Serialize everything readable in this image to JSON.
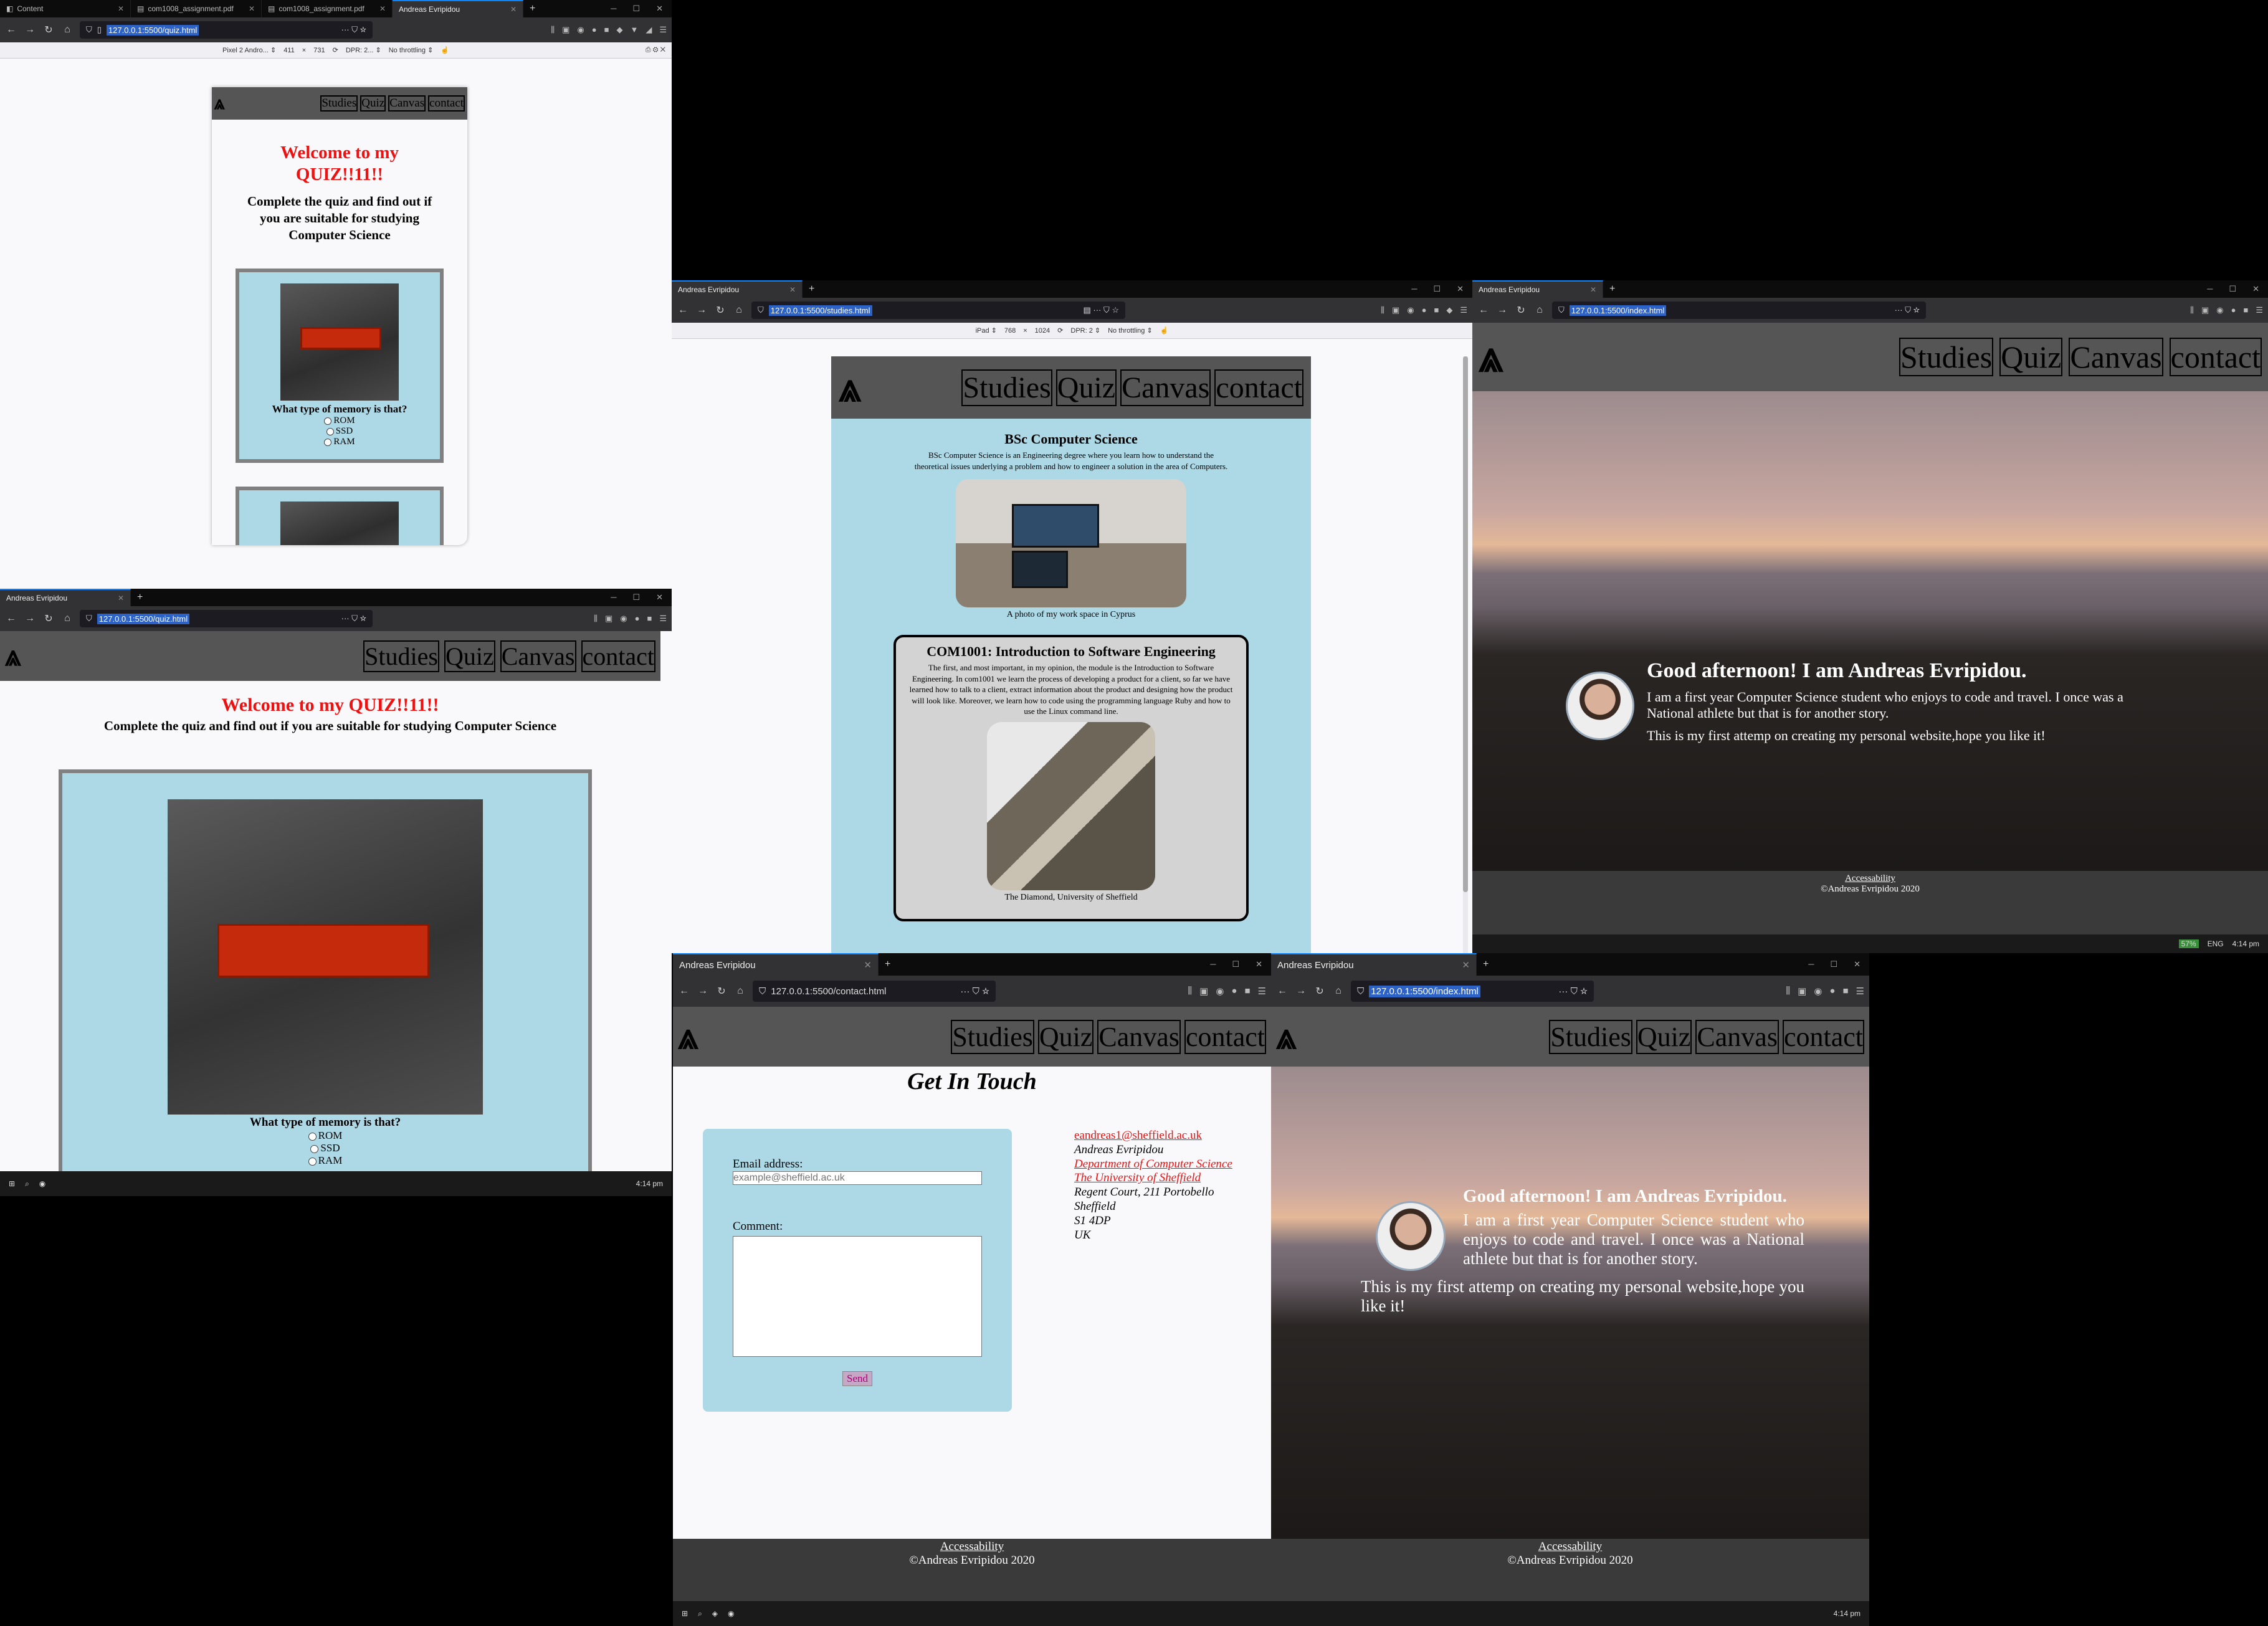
{
  "top_left_window": {
    "tabs": [
      "Content",
      "com1008_assignment.pdf",
      "com1008_assignment.pdf",
      "Andreas Evripidou"
    ],
    "url": "127.0.0.1:5500/quiz.html",
    "device_bar": {
      "device": "Pixel 2 Andro... ⇕",
      "width": "411",
      "x": "×",
      "height": "731",
      "dpr": "DPR: 2... ⇕",
      "throttle": "No throttling ⇕"
    }
  },
  "nav": {
    "studies": "Studies",
    "quiz": "Quiz",
    "canvas": "Canvas",
    "contact": "contact"
  },
  "quiz": {
    "welcome_mobile": "Welcome to my QUIZ!!11!!",
    "subtitle": "Complete the quiz and find out if you are suitable for studying Computer Science",
    "question": "What type of memory is that?",
    "options": [
      "ROM",
      "SSD",
      "RAM"
    ]
  },
  "mid_left_window": {
    "tab": "Andreas Evripidou",
    "url": "127.0.0.1:5500/quiz.html"
  },
  "studies_window": {
    "tab": "Andreas Evripidou",
    "url": "127.0.0.1:5500/studies.html",
    "device_bar": {
      "device": "iPad ⇕",
      "width": "768",
      "x": "×",
      "height": "1024",
      "dpr": "DPR: 2 ⇕",
      "throttle": "No throttling ⇕"
    },
    "section1_title": "BSc Computer Science",
    "section1_text": "BSc Computer Science is an Engineering degree where you learn how to understand the theoretical issues underlying a problem and how to engineer a solution in the area of Computers.",
    "section1_caption": "A photo of my work space in Cyprus",
    "section2_title": "COM1001: Introduction to Software Engineering",
    "section2_text": "The first, and most important, in my opinion, the module is the Introduction to Software Engineering. In com1001 we learn the process of developing a product for a client, so far we have learned how to talk to a client, extract information about the product and designing how the product will look like. Moreover, we learn how to code using the programming language Ruby and how to use the Linux command line.",
    "section2_caption": "The Diamond, University of Sheffield"
  },
  "index_window": {
    "tab": "Andreas Evripidou",
    "url": "127.0.0.1:5500/index.html",
    "greeting": "Good afternoon! I am Andreas Evripidou.",
    "para1": "I am a first year Computer Science student who enjoys to code and travel. I once was a National athlete but that is for another story.",
    "para2": "This is my first attemp on creating my personal website,hope you like it!"
  },
  "footer": {
    "link": "Accessability",
    "copyright": "©Andreas Evripidou 2020"
  },
  "contact_window": {
    "tab": "Andreas Evripidou",
    "url": "127.0.0.1:5500/contact.html",
    "title": "Get In Touch",
    "email_label": "Email address:",
    "email_placeholder": "example@sheffield.ac.uk",
    "comment_label": "Comment:",
    "send": "Send",
    "email_link": "eandreas1@sheffield.ac.uk",
    "addr_name": "Andreas Evripidou",
    "addr_dept": "Department of Computer Science",
    "addr_uni": "The University of Sheffield",
    "addr_street": "Regent Court, 211 Portobello",
    "addr_city": "Sheffield",
    "addr_post": "S1 4DP",
    "addr_country": "UK"
  },
  "index2_window": {
    "tab": "Andreas Evripidou",
    "url": "127.0.0.1:5500/index.html"
  },
  "taskbar": {
    "time": "4:14 pm",
    "lang": "ENG",
    "battery": "57%"
  }
}
